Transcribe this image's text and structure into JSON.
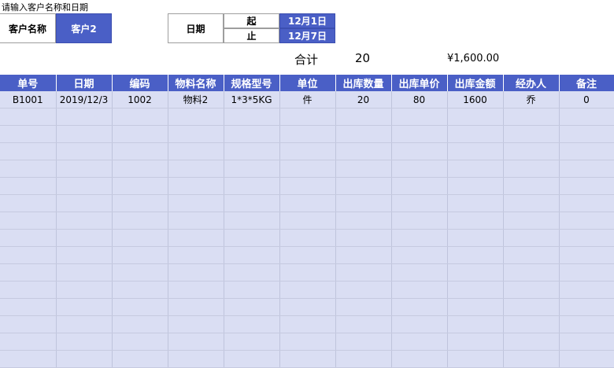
{
  "prompt": "请输入客户名称和日期",
  "customer": {
    "label": "客户名称",
    "value": "客户2"
  },
  "date": {
    "label": "日期",
    "start_label": "起",
    "start_value": "12月1日",
    "end_label": "止",
    "end_value": "12月7日"
  },
  "summary": {
    "label": "合计",
    "quantity": "20",
    "amount": "¥1,600.00"
  },
  "columns": [
    "单号",
    "日期",
    "编码",
    "物料名称",
    "规格型号",
    "单位",
    "出库数量",
    "出库单价",
    "出库金额",
    "经办人",
    "备注"
  ],
  "rows": [
    [
      "B1001",
      "2019/12/3",
      "1002",
      "物料2",
      "1*3*5KG",
      "件",
      "20",
      "80",
      "1600",
      "乔",
      "0"
    ],
    [
      "",
      "",
      "",
      "",
      "",
      "",
      "",
      "",
      "",
      "",
      ""
    ],
    [
      "",
      "",
      "",
      "",
      "",
      "",
      "",
      "",
      "",
      "",
      ""
    ],
    [
      "",
      "",
      "",
      "",
      "",
      "",
      "",
      "",
      "",
      "",
      ""
    ],
    [
      "",
      "",
      "",
      "",
      "",
      "",
      "",
      "",
      "",
      "",
      ""
    ],
    [
      "",
      "",
      "",
      "",
      "",
      "",
      "",
      "",
      "",
      "",
      ""
    ],
    [
      "",
      "",
      "",
      "",
      "",
      "",
      "",
      "",
      "",
      "",
      ""
    ],
    [
      "",
      "",
      "",
      "",
      "",
      "",
      "",
      "",
      "",
      "",
      ""
    ],
    [
      "",
      "",
      "",
      "",
      "",
      "",
      "",
      "",
      "",
      "",
      ""
    ],
    [
      "",
      "",
      "",
      "",
      "",
      "",
      "",
      "",
      "",
      "",
      ""
    ],
    [
      "",
      "",
      "",
      "",
      "",
      "",
      "",
      "",
      "",
      "",
      ""
    ],
    [
      "",
      "",
      "",
      "",
      "",
      "",
      "",
      "",
      "",
      "",
      ""
    ],
    [
      "",
      "",
      "",
      "",
      "",
      "",
      "",
      "",
      "",
      "",
      ""
    ],
    [
      "",
      "",
      "",
      "",
      "",
      "",
      "",
      "",
      "",
      "",
      ""
    ],
    [
      "",
      "",
      "",
      "",
      "",
      "",
      "",
      "",
      "",
      "",
      ""
    ],
    [
      "",
      "",
      "",
      "",
      "",
      "",
      "",
      "",
      "",
      "",
      ""
    ]
  ],
  "colors": {
    "header_blue": "#4a5fc6",
    "row_fill": "#dadef3"
  }
}
